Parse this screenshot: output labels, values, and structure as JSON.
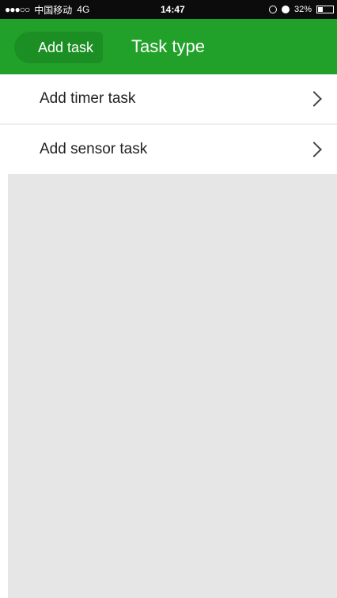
{
  "status_bar": {
    "signal_dots": "●●●○○",
    "carrier": "中国移动",
    "network": "4G",
    "time": "14:47",
    "battery_percent": "32%",
    "battery_level": 0.32
  },
  "nav_bar": {
    "back_label": "Add task",
    "title": "Task type",
    "color": "#22a12a"
  },
  "list": {
    "items": [
      {
        "label": "Add timer task"
      },
      {
        "label": "Add sensor task"
      }
    ]
  },
  "icons": {
    "chevron": "chevron-right-icon"
  }
}
